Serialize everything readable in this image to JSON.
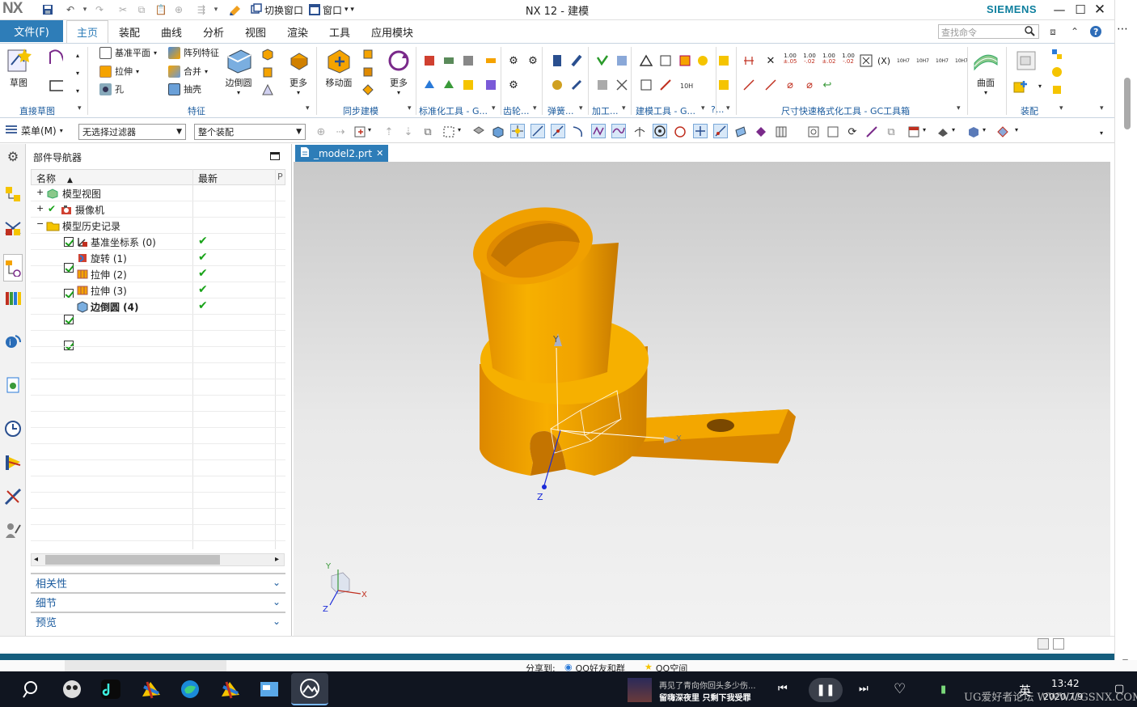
{
  "app": {
    "logo": "NX",
    "title": "NX 12 - 建模",
    "brand": "SIEMENS",
    "switch_window": "切换窗口",
    "window_menu": "窗口"
  },
  "tabs": {
    "file": "文件(F)",
    "items": [
      "主页",
      "装配",
      "曲线",
      "分析",
      "视图",
      "渲染",
      "工具",
      "应用模块"
    ]
  },
  "search": {
    "placeholder": "查找命令"
  },
  "ribbon": {
    "sketch": {
      "btn": "草图",
      "label": "直接草图"
    },
    "feature": {
      "datum_plane": "基准平面",
      "pattern": "阵列特征",
      "extrude": "拉伸",
      "combine": "合并",
      "hole": "孔",
      "shell": "抽壳",
      "edge_blend": "边倒圆",
      "more": "更多",
      "label": "特征"
    },
    "sync": {
      "move_face": "移动面",
      "more": "更多",
      "label": "同步建模"
    },
    "std": {
      "label": "标准化工具 - G..."
    },
    "gear": {
      "label": "齿轮..."
    },
    "spring": {
      "label": "弹簧..."
    },
    "machining": {
      "label": "加工..."
    },
    "build": {
      "label": "建模工具 - G..."
    },
    "more": {
      "label": "?..."
    },
    "dim": {
      "label": "尺寸快速格式化工具 - GC工具箱",
      "vals": [
        "1.00",
        "1.00",
        "1.00",
        "1.00"
      ]
    },
    "surface": {
      "btn": "曲面"
    },
    "assembly": {
      "label": "装配"
    }
  },
  "selection": {
    "menu": "菜单(M)",
    "filter": "无选择过滤器",
    "scope": "整个装配"
  },
  "navigator": {
    "title": "部件导航器",
    "col_name": "名称",
    "col_latest": "最新",
    "items": [
      {
        "label": "模型视图"
      },
      {
        "label": "摄像机"
      },
      {
        "label": "模型历史记录"
      },
      {
        "label": "基准坐标系 (0)"
      },
      {
        "label": "旋转 (1)"
      },
      {
        "label": "拉伸 (2)"
      },
      {
        "label": "拉伸 (3)"
      },
      {
        "label": "边倒圆 (4)"
      }
    ],
    "panels": [
      "相关性",
      "细节",
      "预览"
    ]
  },
  "viewport": {
    "tab": "_model2.prt",
    "axis": {
      "x": "X",
      "y": "Y",
      "z": "Z"
    }
  },
  "statusbar": {
    "share": "分享到:",
    "qq_friends": "QQ好友和群",
    "qq_zone": "QQ空间"
  },
  "taskbar": {
    "news1": "再见了青向你回头多少伤...",
    "news2": "留嗨深夜里 只剩下我受罪",
    "ime": "英",
    "time": "13:42",
    "date": "2020/7/9",
    "watermark": "UG爱好者论坛 WWW.UGSNX.COM"
  },
  "colors": {
    "accent": "#2e7db8",
    "part": "#f5a300",
    "status_line": "#165e7e"
  }
}
